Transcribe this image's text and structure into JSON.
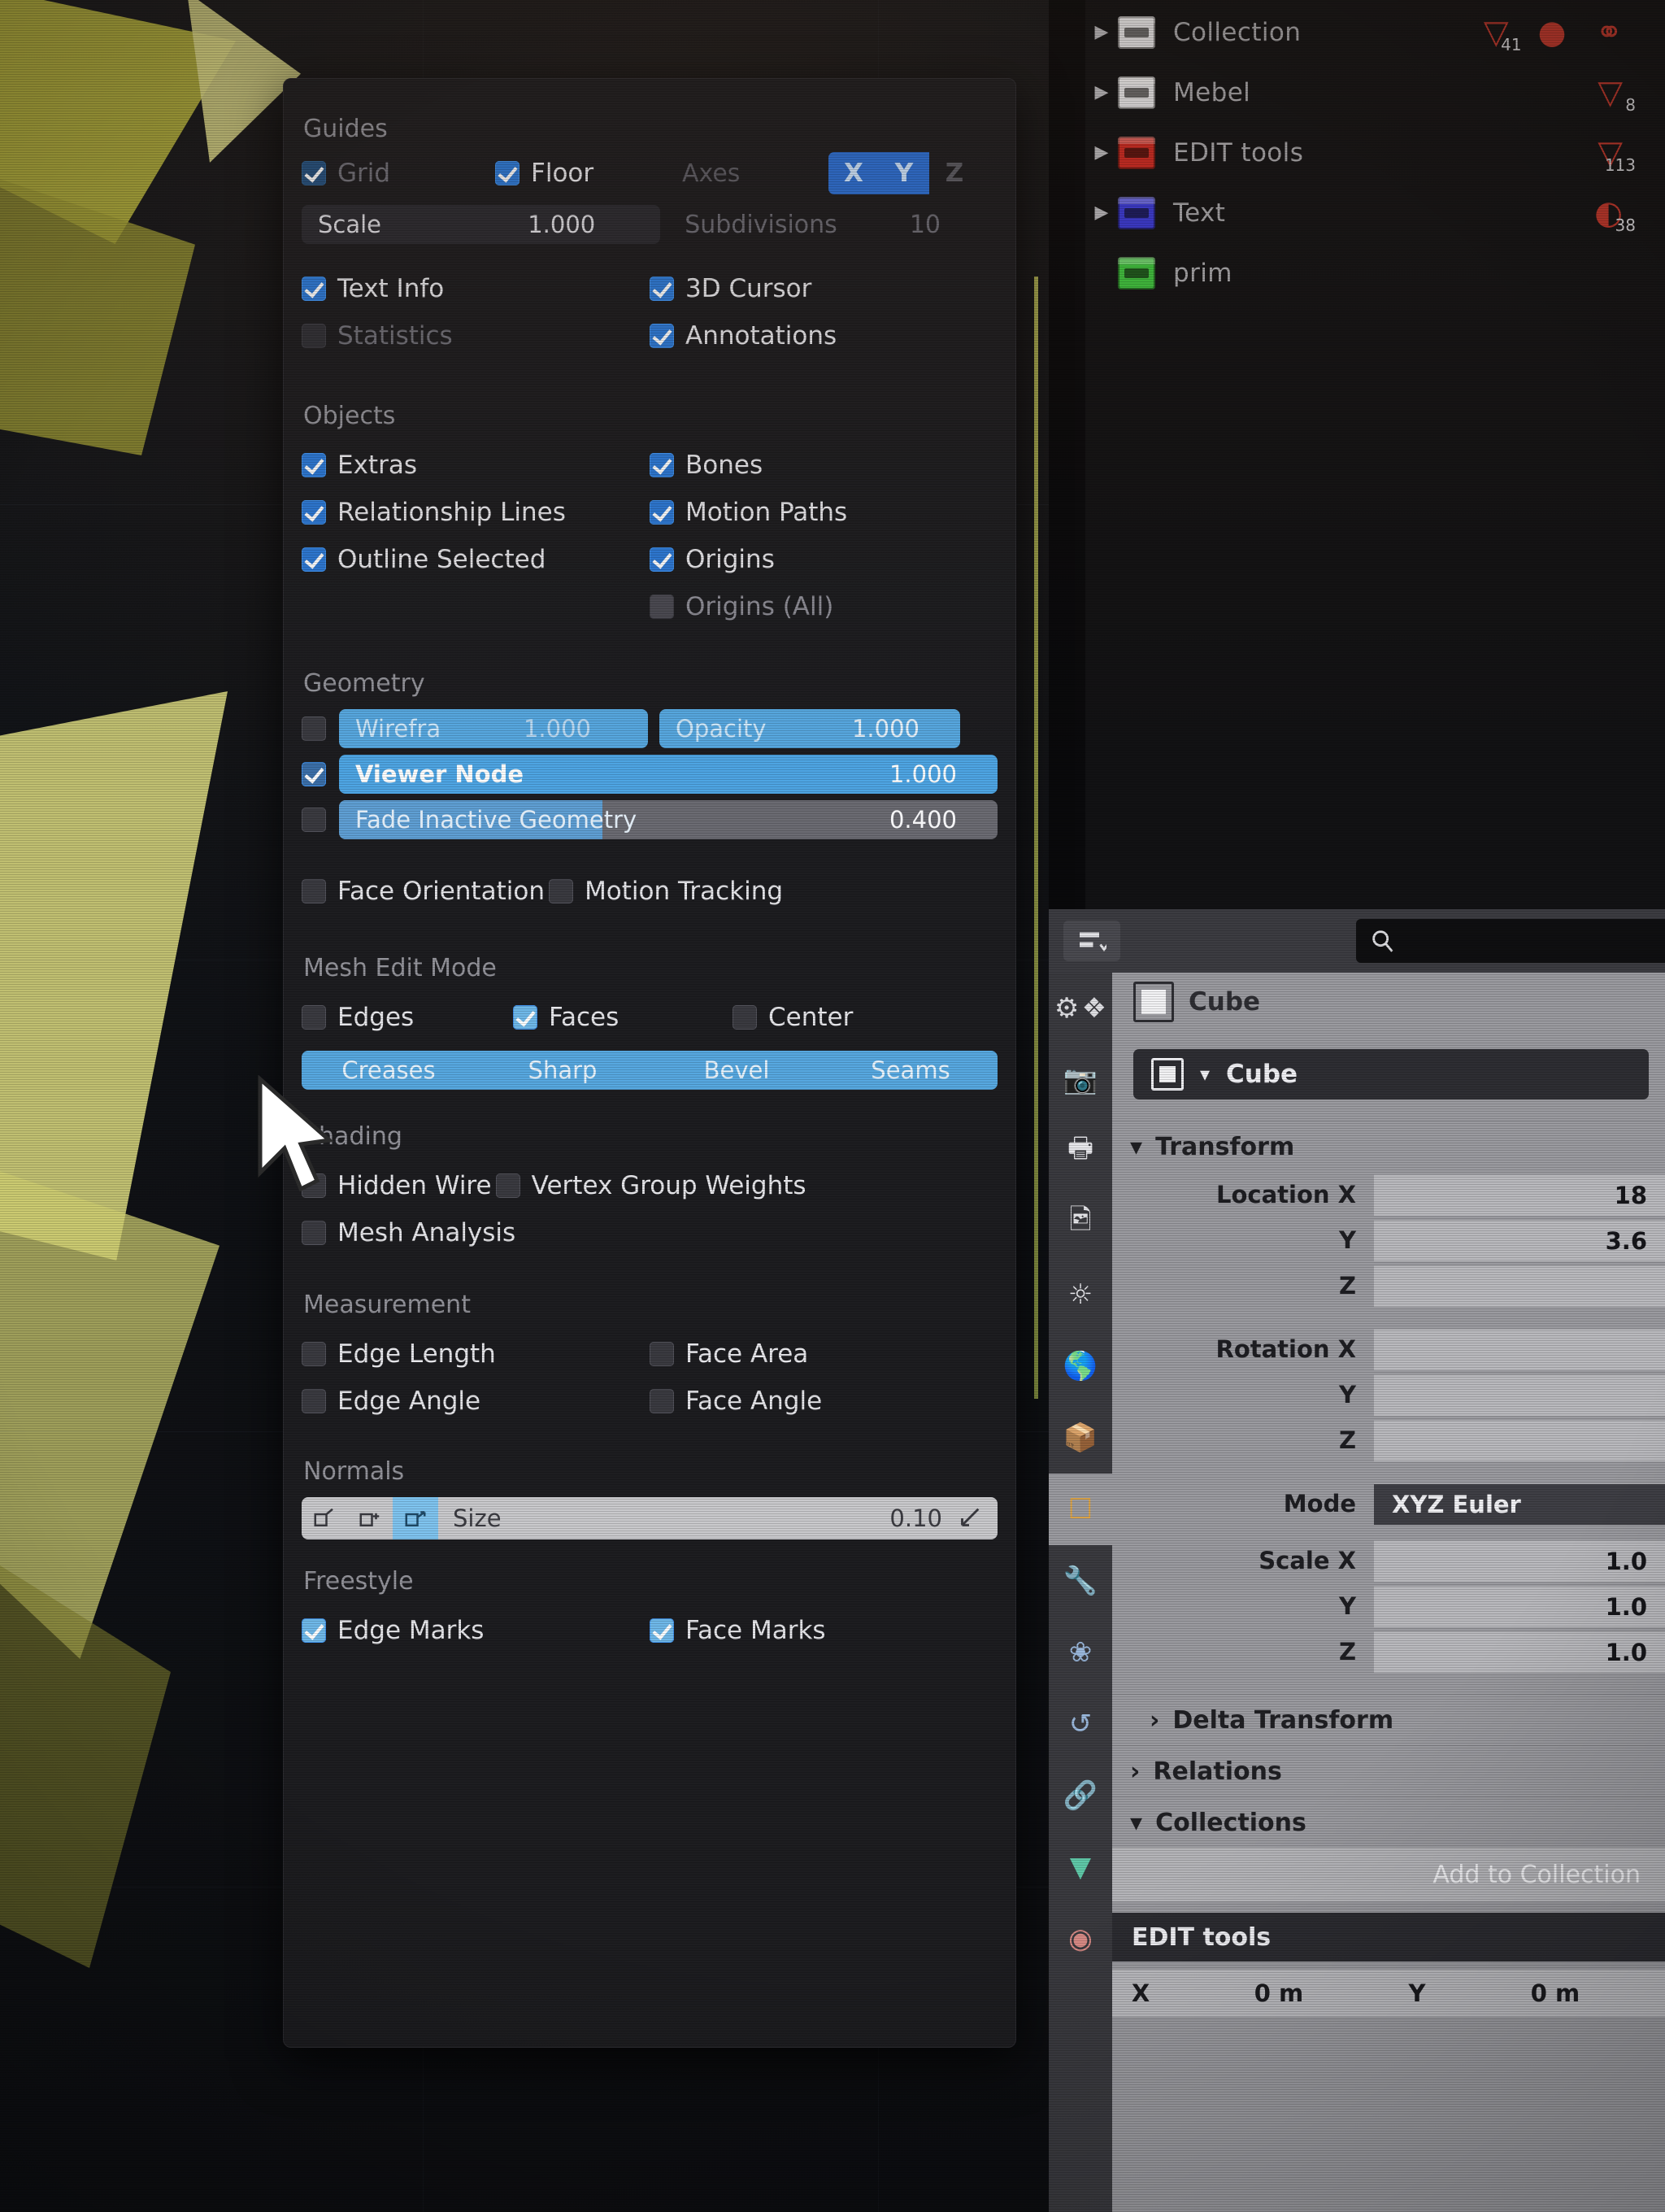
{
  "outliner": {
    "rows": [
      {
        "label": "Collection",
        "color": "#e8e8ea",
        "badges": [
          {
            "glyph": "▽",
            "count": "41"
          },
          {
            "glyph": "●",
            "count": ""
          },
          {
            "glyph": "⚯",
            "count": ""
          }
        ]
      },
      {
        "label": "Mebel",
        "color": "#e8e8ea",
        "badges": [
          {
            "glyph": "▽",
            "count": "8"
          }
        ]
      },
      {
        "label": "EDIT tools",
        "color": "#cc2a22",
        "badges": [
          {
            "glyph": "▽",
            "count": "113"
          }
        ]
      },
      {
        "label": "Text",
        "color": "#3a3ad6",
        "badges": [
          {
            "glyph": "◔",
            "count": "38"
          }
        ]
      },
      {
        "label": "prim",
        "color": "#3fc43f",
        "badges": []
      }
    ],
    "expand_icon": "▶"
  },
  "overlay_popover": {
    "guides": {
      "title": "Guides",
      "grid": {
        "label": "Grid",
        "checked": true,
        "dim": true
      },
      "floor": {
        "label": "Floor",
        "checked": true,
        "dim": false
      },
      "axes": {
        "label": "Axes",
        "dim": true
      },
      "axis_toggles": [
        {
          "label": "X",
          "on": true
        },
        {
          "label": "Y",
          "on": true
        },
        {
          "label": "Z",
          "on": false
        }
      ],
      "scale": {
        "label": "Scale",
        "value": "1.000"
      },
      "subdivisions": {
        "label": "Subdivisions",
        "value": "10"
      },
      "text_info": {
        "label": "Text Info",
        "checked": true
      },
      "statistics": {
        "label": "Statistics",
        "checked": false,
        "dim": true
      },
      "cursor_3d": {
        "label": "3D Cursor",
        "checked": true
      },
      "annotations": {
        "label": "Annotations",
        "checked": true
      }
    },
    "objects": {
      "title": "Objects",
      "items": [
        {
          "label": "Extras",
          "checked": true
        },
        {
          "label": "Bones",
          "checked": true
        },
        {
          "label": "Relationship Lines",
          "checked": true
        },
        {
          "label": "Motion Paths",
          "checked": true
        },
        {
          "label": "Outline Selected",
          "checked": true
        },
        {
          "label": "Origins",
          "checked": true
        },
        {
          "label": "Origins (All)",
          "checked": false,
          "dim": true
        }
      ]
    },
    "geometry": {
      "title": "Geometry",
      "wireframe": {
        "label": "Wirefra",
        "value": "1.000",
        "checked": false
      },
      "opacity": {
        "label": "Opacity",
        "value": "1.000"
      },
      "viewer_node": {
        "label": "Viewer Node",
        "value": "1.000",
        "checked": true
      },
      "fade_inactive": {
        "label": "Fade Inactive Geometry",
        "value": "0.400",
        "checked": false,
        "fill_pct": "40%"
      },
      "face_orientation": {
        "label": "Face Orientation",
        "checked": false
      },
      "motion_tracking": {
        "label": "Motion Tracking",
        "checked": false
      }
    },
    "mesh_edit_mode": {
      "title": "Mesh Edit Mode",
      "edges": {
        "label": "Edges",
        "checked": false
      },
      "faces": {
        "label": "Faces",
        "checked": true
      },
      "center": {
        "label": "Center",
        "checked": false
      },
      "segments": [
        "Creases",
        "Sharp",
        "Bevel",
        "Seams"
      ]
    },
    "shading": {
      "title": "Shading",
      "items": [
        {
          "label": "Hidden Wire",
          "checked": false
        },
        {
          "label": "Vertex Group Weights",
          "checked": false
        },
        {
          "label": "Mesh Analysis",
          "checked": false
        }
      ]
    },
    "measurement": {
      "title": "Measurement",
      "items": [
        {
          "label": "Edge Length",
          "checked": false
        },
        {
          "label": "Face Area",
          "checked": false
        },
        {
          "label": "Edge Angle",
          "checked": false
        },
        {
          "label": "Face Angle",
          "checked": false
        }
      ]
    },
    "normals": {
      "title": "Normals",
      "icons": [
        {
          "name": "vertex-normals-icon",
          "glyph": "◱",
          "on": false
        },
        {
          "name": "split-normals-icon",
          "glyph": "◰",
          "on": false
        },
        {
          "name": "face-normals-icon",
          "glyph": "◳",
          "on": true
        }
      ],
      "size": {
        "label": "Size",
        "value": "0.10"
      }
    },
    "freestyle": {
      "title": "Freestyle",
      "edge_marks": {
        "label": "Edge Marks",
        "checked": true
      },
      "face_marks": {
        "label": "Face Marks",
        "checked": true
      }
    }
  },
  "properties": {
    "header": {
      "editor_type_icon": "▤",
      "search_icon": "⌕",
      "search_value": ""
    },
    "tabs": [
      {
        "name": "tool",
        "glyph": "⚒",
        "active": false
      },
      {
        "name": "render",
        "glyph": "▣",
        "active": false
      },
      {
        "name": "output",
        "glyph": "⎙",
        "active": false
      },
      {
        "name": "view-layer",
        "glyph": "❐",
        "active": false
      },
      {
        "name": "scene",
        "glyph": "◑",
        "active": false
      },
      {
        "name": "world",
        "glyph": "◎",
        "active": false
      },
      {
        "name": "collection",
        "glyph": "❑",
        "active": false
      },
      {
        "name": "object",
        "glyph": "□",
        "active": true
      },
      {
        "name": "modifiers",
        "glyph": "⚙",
        "active": false
      },
      {
        "name": "particles",
        "glyph": "✻",
        "active": false
      },
      {
        "name": "physics",
        "glyph": "↻",
        "active": false
      },
      {
        "name": "constraints",
        "glyph": "⛓",
        "active": false
      },
      {
        "name": "data",
        "glyph": "▽",
        "active": false
      },
      {
        "name": "material",
        "glyph": "◕",
        "active": false
      }
    ],
    "breadcrumb": "Cube",
    "object_name": "Cube",
    "transform": {
      "title": "Transform",
      "location": {
        "label": "Location X",
        "axes": [
          "X",
          "Y",
          "Z"
        ],
        "values": [
          "18",
          "3.6",
          ""
        ]
      },
      "rotation": {
        "label": "Rotation X",
        "axes": [
          "X",
          "Y",
          "Z"
        ],
        "values": [
          "",
          "",
          ""
        ]
      },
      "mode": {
        "label": "Mode",
        "value": "XYZ Euler"
      },
      "scale": {
        "label": "Scale X",
        "axes": [
          "X",
          "Y",
          "Z"
        ],
        "values": [
          "1.0",
          "1.0",
          "1.0"
        ]
      }
    },
    "delta_transform": {
      "label": "Delta Transform",
      "expanded": false,
      "chevron": "›"
    },
    "relations": {
      "label": "Relations",
      "expanded": false,
      "chevron": "›"
    },
    "collections": {
      "label": "Collections",
      "expanded": true,
      "chevron": "⌄",
      "add_button": "Add to Collection",
      "entry": "EDIT tools",
      "offset": [
        {
          "key": "X",
          "value": "0 m"
        },
        {
          "key": "Y",
          "value": "0 m"
        }
      ]
    }
  }
}
